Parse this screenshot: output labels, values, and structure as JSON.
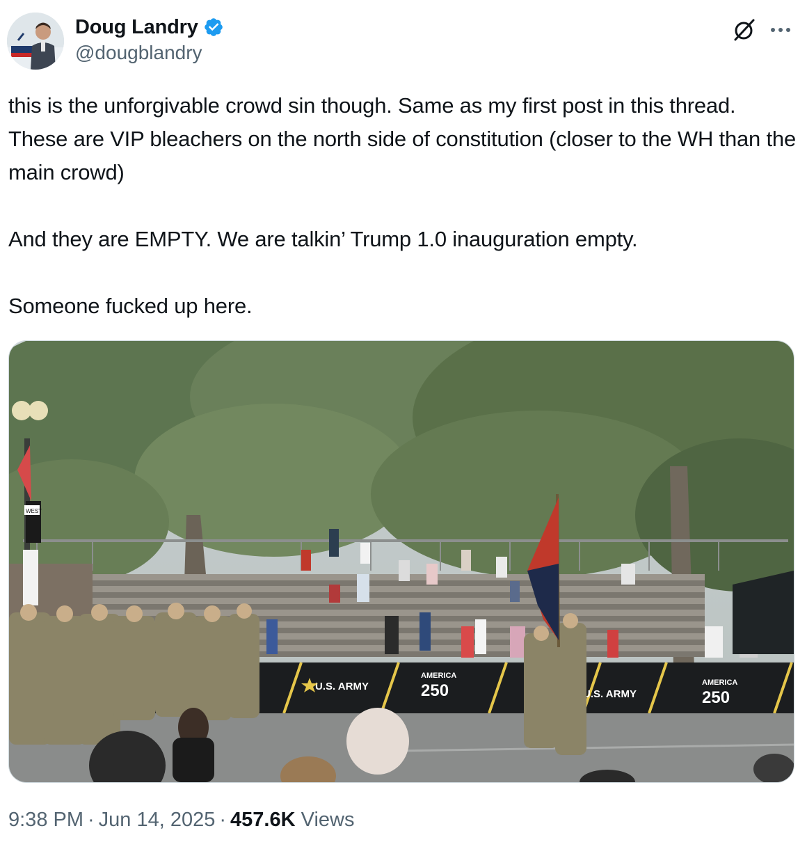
{
  "author": {
    "display_name": "Doug Landry",
    "handle": "@dougblandry",
    "verified": true,
    "avatar_icon": "avatar-photo-icon"
  },
  "actions": {
    "grok_icon": "grok-icon",
    "more_icon": "more-icon"
  },
  "tweet": {
    "text": "this is the unforgivable crowd sin though. Same as my first post in this thread. These are VIP bleachers on the north side of constitution (closer to the WH than the main crowd)\n\nAnd they are EMPTY. We are talkin’ Trump 1.0 inauguration empty.\n\nSomeone fucked up here."
  },
  "media": {
    "banner_labels": [
      "U.S. ARMY",
      "AMERICA",
      "250",
      "U.S. ARMY",
      "AMERICA",
      "250"
    ],
    "street_sign": "WEST"
  },
  "meta": {
    "time": "9:38 PM",
    "date": "Jun 14, 2025",
    "separator": "·",
    "views_count": "457.6K",
    "views_label": "Views"
  },
  "colors": {
    "text": "#0f1419",
    "secondary": "#536471",
    "verified": "#1d9bf0",
    "border": "#cfd9de"
  }
}
